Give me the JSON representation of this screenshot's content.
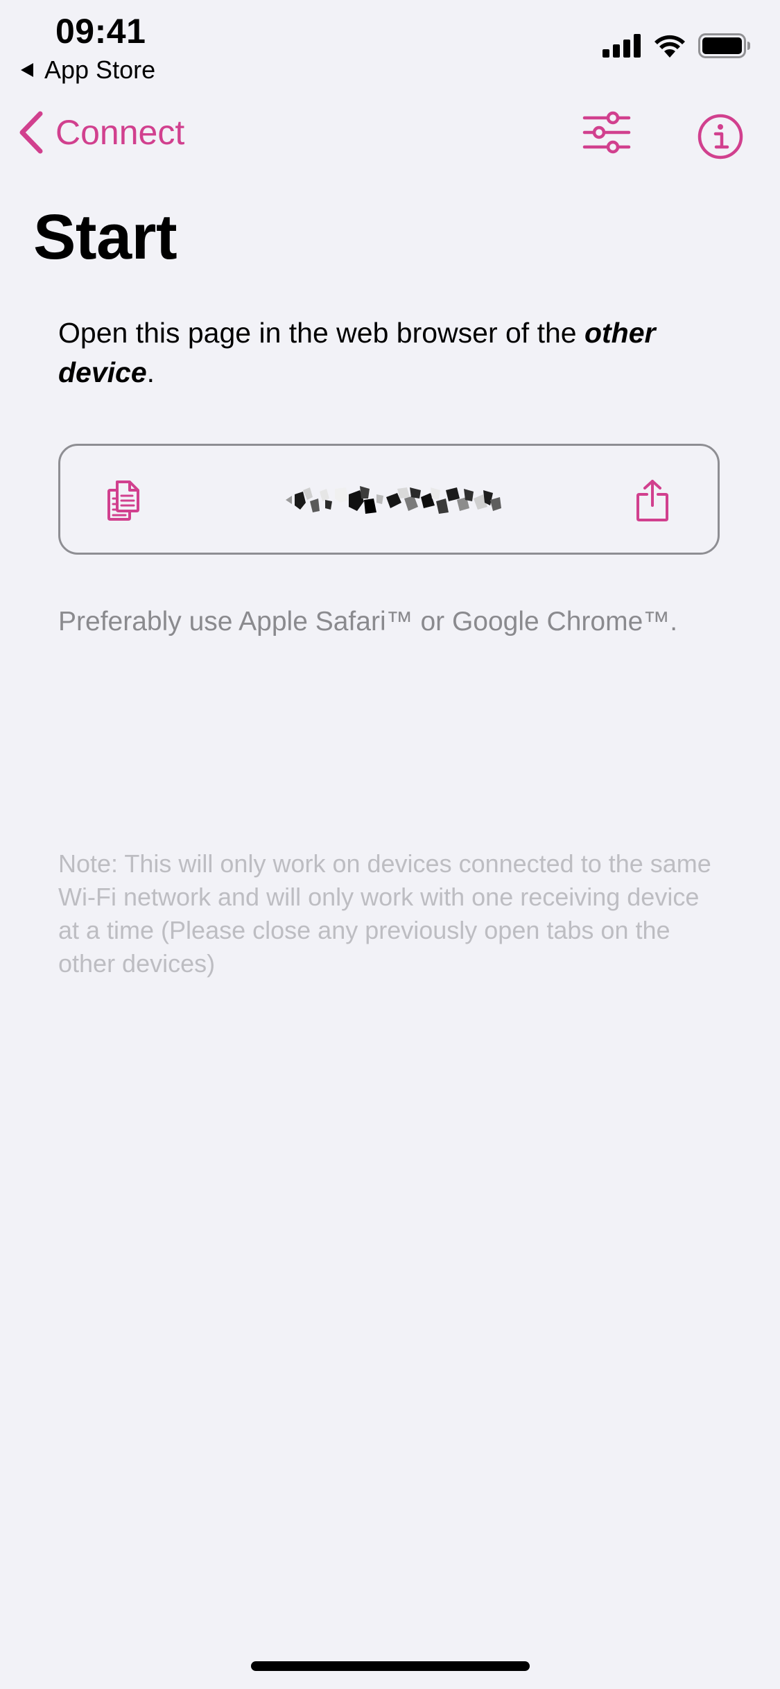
{
  "status_bar": {
    "time": "09:41",
    "back_app": "App Store"
  },
  "nav": {
    "back_label": "Connect",
    "icons": [
      "sliders-icon",
      "info-icon"
    ]
  },
  "page": {
    "title": "Start",
    "instruction_prefix": "Open this page in the web browser of the ",
    "instruction_emphasis": "other device",
    "instruction_suffix": ".",
    "url_value": "",
    "hint": "Preferably use Apple Safari™ or Google Chrome™.",
    "note": "Note: This will only work on devices connected to the same Wi-Fi network and will only work with one receiving device at a time (Please close any previously open tabs on the other devices)"
  },
  "colors": {
    "accent": "#D1408E",
    "background": "#F2F2F7",
    "secondary_text": "#8A8A8E",
    "tertiary_text": "#BDBDC2"
  }
}
